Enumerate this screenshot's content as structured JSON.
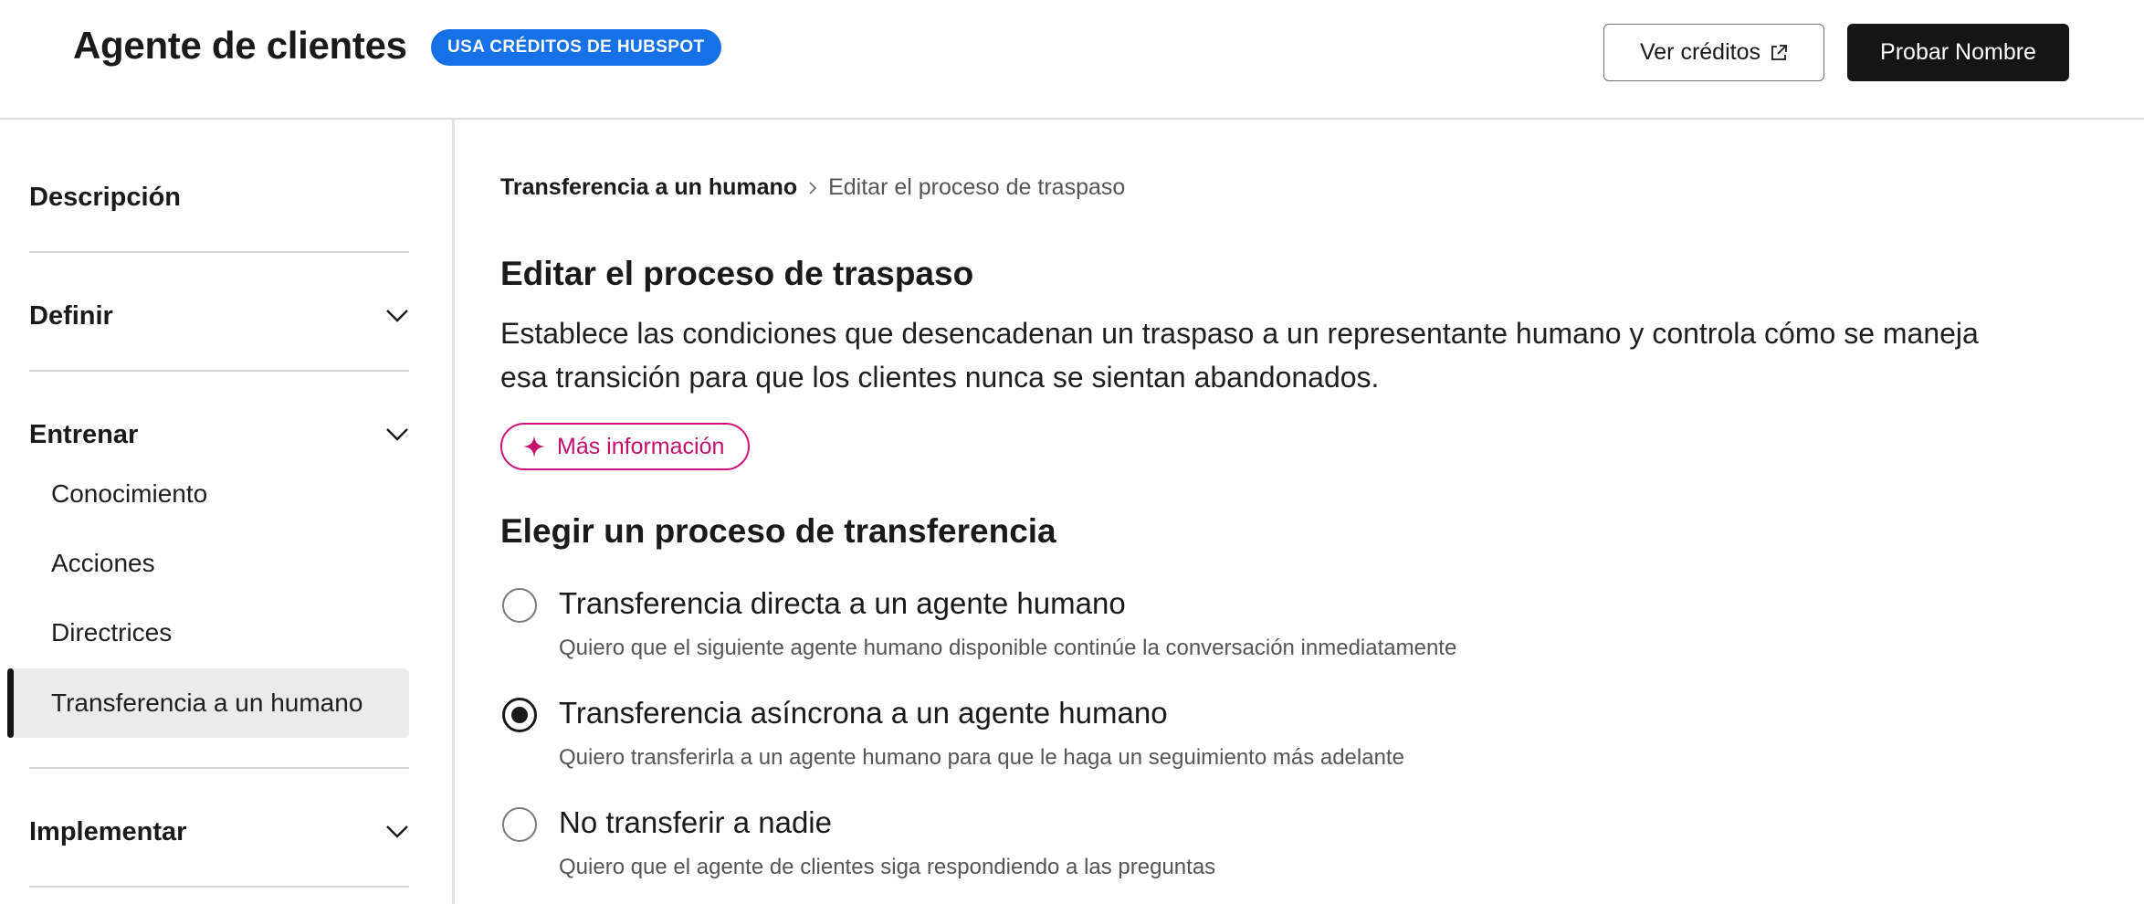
{
  "header": {
    "title": "Agente de clientes",
    "badge": "USA CRÉDITOS DE HUBSPOT",
    "view_credits_label": "Ver créditos",
    "try_button_label": "Probar Nombre"
  },
  "sidebar": {
    "sections": [
      {
        "label": "Descripción"
      },
      {
        "label": "Definir"
      },
      {
        "label": "Entrenar",
        "items": [
          "Conocimiento",
          "Acciones",
          "Directrices",
          "Transferencia a un humano"
        ]
      },
      {
        "label": "Implementar"
      }
    ],
    "active_item": "Transferencia a un humano"
  },
  "breadcrumb": {
    "parent": "Transferencia a un humano",
    "current": "Editar el proceso de traspaso"
  },
  "main": {
    "title": "Editar el proceso de traspaso",
    "description": "Establece las condiciones que desencadenan un traspaso a un representante humano y controla cómo se maneja esa transición para que los clientes nunca se sientan abandonados.",
    "learn_more_label": "Más información",
    "section_title": "Elegir un proceso de transferencia",
    "options": [
      {
        "label": "Transferencia directa a un agente humano",
        "description": "Quiero que el siguiente agente humano disponible continúe la conversación inmediatamente",
        "selected": false
      },
      {
        "label": "Transferencia asíncrona a un agente humano",
        "description": "Quiero transferirla a un agente humano para que le haga un seguimiento más adelante",
        "selected": true
      },
      {
        "label": "No transferir a nadie",
        "description": "Quiero que el agente de clientes siga respondiendo a las preguntas",
        "selected": false
      }
    ]
  },
  "colors": {
    "badge_bg": "#1670e6",
    "primary_button_bg": "#151515",
    "learn_more_accent": "#d1127a",
    "active_nav_bg": "#ebebeb"
  },
  "icons": {
    "external_link": "external-link-icon",
    "chevron": "chevron-down-icon",
    "breadcrumb_separator": "chevron-right-icon",
    "sparkle": "sparkle-icon"
  }
}
